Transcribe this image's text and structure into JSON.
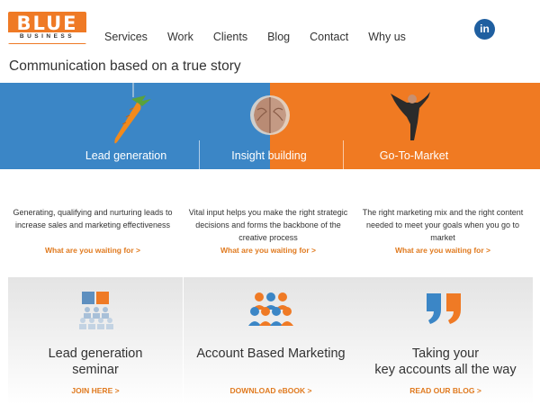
{
  "logo": {
    "main": "BLUE",
    "sub": "BUSINESS"
  },
  "nav": [
    "Services",
    "Work",
    "Clients",
    "Blog",
    "Contact",
    "Why us"
  ],
  "social": {
    "linkedin_label": "in"
  },
  "tagline": "Communication based on a true story",
  "banner": {
    "items": [
      {
        "label": "Lead generation",
        "icon": "carrot-icon"
      },
      {
        "label": "Insight building",
        "icon": "brain-icon"
      },
      {
        "label": "Go-To-Market",
        "icon": "diver-icon"
      }
    ]
  },
  "columns": [
    {
      "text": "Generating, qualifying and nurturing leads to increase sales and marketing effectiveness",
      "link": "What are you waiting for >"
    },
    {
      "text": "Vital input helps you make the right strategic decisions and forms the backbone of the creative process",
      "link": "What are you waiting for >"
    },
    {
      "text": "The right marketing mix and the right content needed to meet your goals when you go to market",
      "link": "What are you waiting for >"
    }
  ],
  "cards": [
    {
      "title_line1": "Lead generation",
      "title_line2": "seminar",
      "cta": "JOIN HERE >",
      "icon": "seminar-icon"
    },
    {
      "title_line1": "Account Based Marketing",
      "title_line2": "",
      "cta": "DOWNLOAD eBOOK >",
      "icon": "people-group-icon"
    },
    {
      "title_line1": "Taking your",
      "title_line2": "key accounts all the way",
      "cta": "READ OUR BLOG >",
      "icon": "quote-icon"
    }
  ],
  "colors": {
    "orange": "#f07a22",
    "blue": "#3b86c6",
    "link": "#e07a1f"
  }
}
